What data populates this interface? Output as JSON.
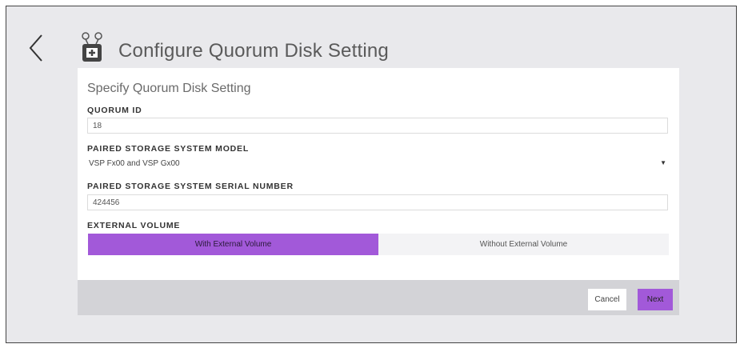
{
  "header": {
    "back_icon": "chevron-left-icon",
    "title_icon": "quorum-disk-icon",
    "title": "Configure Quorum Disk Setting"
  },
  "card": {
    "title": "Specify Quorum Disk Setting",
    "quorum_id": {
      "label": "QUORUM ID",
      "value": "18"
    },
    "model": {
      "label": "PAIRED STORAGE SYSTEM MODEL",
      "value": "VSP Fx00 and VSP Gx00"
    },
    "serial": {
      "label": "PAIRED STORAGE SYSTEM SERIAL NUMBER",
      "value": "424456"
    },
    "external_volume": {
      "label": "EXTERNAL VOLUME",
      "options": [
        "With External Volume",
        "Without External Volume"
      ],
      "selected": "With External Volume"
    }
  },
  "footer": {
    "cancel_label": "Cancel",
    "next_label": "Next"
  },
  "colors": {
    "accent": "#a259d9",
    "page_bg": "#e9e9ec",
    "footer_bg": "#d3d3d7"
  }
}
